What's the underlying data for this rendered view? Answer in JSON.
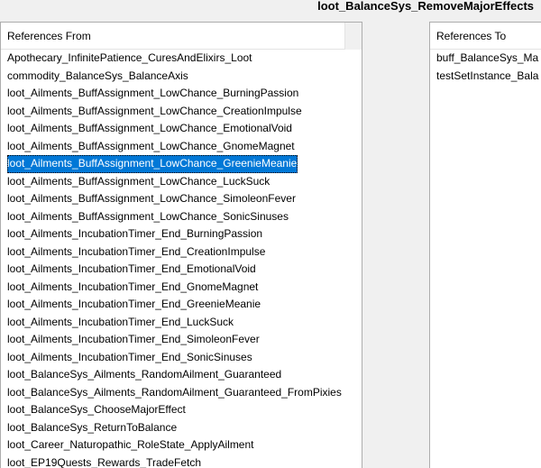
{
  "window": {
    "title": "loot_BalanceSys_RemoveMajorEffects"
  },
  "left_panel": {
    "header": "References From",
    "selected_index": 6,
    "items": [
      "Apothecary_InfinitePatience_CuresAndElixirs_Loot",
      "commodity_BalanceSys_BalanceAxis",
      "loot_Ailments_BuffAssignment_LowChance_BurningPassion",
      "loot_Ailments_BuffAssignment_LowChance_CreationImpulse",
      "loot_Ailments_BuffAssignment_LowChance_EmotionalVoid",
      "loot_Ailments_BuffAssignment_LowChance_GnomeMagnet",
      "loot_Ailments_BuffAssignment_LowChance_GreenieMeanie",
      "loot_Ailments_BuffAssignment_LowChance_LuckSuck",
      "loot_Ailments_BuffAssignment_LowChance_SimoleonFever",
      "loot_Ailments_BuffAssignment_LowChance_SonicSinuses",
      "loot_Ailments_IncubationTimer_End_BurningPassion",
      "loot_Ailments_IncubationTimer_End_CreationImpulse",
      "loot_Ailments_IncubationTimer_End_EmotionalVoid",
      "loot_Ailments_IncubationTimer_End_GnomeMagnet",
      "loot_Ailments_IncubationTimer_End_GreenieMeanie",
      "loot_Ailments_IncubationTimer_End_LuckSuck",
      "loot_Ailments_IncubationTimer_End_SimoleonFever",
      "loot_Ailments_IncubationTimer_End_SonicSinuses",
      "loot_BalanceSys_Ailments_RandomAilment_Guaranteed",
      "loot_BalanceSys_Ailments_RandomAilment_Guaranteed_FromPixies",
      "loot_BalanceSys_ChooseMajorEffect",
      "loot_BalanceSys_ReturnToBalance",
      "loot_Career_Naturopathic_RoleState_ApplyAilment",
      "loot_EP19Quests_Rewards_TradeFetch"
    ]
  },
  "right_panel": {
    "header": "References To",
    "items": [
      "buff_BalanceSys_Ma",
      "testSetInstance_Bala"
    ]
  }
}
